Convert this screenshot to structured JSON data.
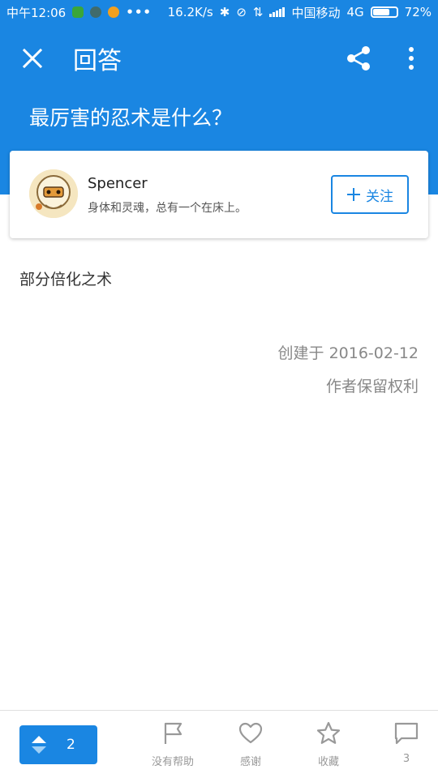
{
  "status_bar": {
    "time": "中午12:06",
    "speed": "16.2K/s",
    "carrier": "中国移动",
    "network": "4G",
    "battery_level": "72%"
  },
  "toolbar": {
    "title": "回答"
  },
  "question": {
    "title": "最厉害的忍术是什么？"
  },
  "author": {
    "name": "Spencer",
    "bio": "身体和灵魂，总有一个在床上。",
    "follow_label": "关注"
  },
  "answer": {
    "text": "部分倍化之术",
    "created": "创建于 2016-02-12",
    "rights": "作者保留权利"
  },
  "bottom_bar": {
    "vote_count": "2",
    "not_helpful_label": "没有帮助",
    "thanks_label": "感谢",
    "collect_label": "收藏",
    "comment_count": "3"
  },
  "colors": {
    "primary": "#1a86e2",
    "icon_gray": "#999999"
  }
}
